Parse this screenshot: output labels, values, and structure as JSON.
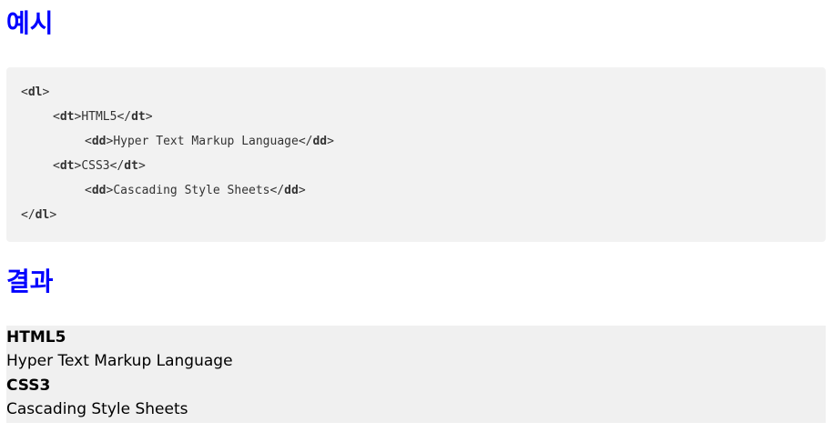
{
  "headings": {
    "example": "예시",
    "result": "결과"
  },
  "code": {
    "open_lt": "<",
    "open_gt": ">",
    "close_lt": "</",
    "tag_dl": "dl",
    "tag_dt": "dt",
    "tag_dd": "dd",
    "lines": {
      "dt1_text": "HTML5",
      "dd1_text": "Hyper Text Markup Language",
      "dt2_text": "CSS3",
      "dd2_text": "Cascading Style Sheets"
    }
  },
  "result": {
    "items": [
      {
        "term": "HTML5",
        "desc": "Hyper Text Markup Language"
      },
      {
        "term": "CSS3",
        "desc": "Cascading Style Sheets"
      }
    ]
  },
  "colors": {
    "heading": "#0000ff",
    "code_bg": "#f2f2f2",
    "result_bg": "#f0f0f0"
  }
}
